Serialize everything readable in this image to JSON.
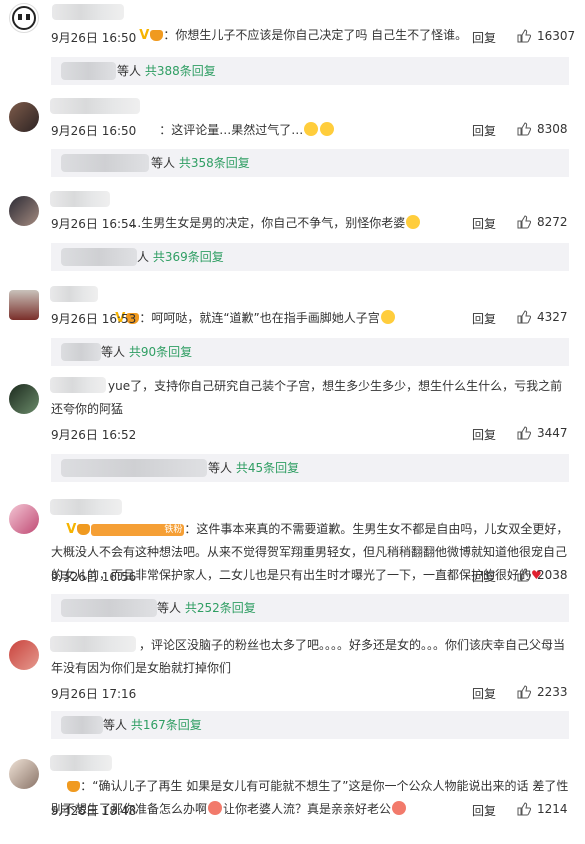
{
  "comments": [
    {
      "text": "：你想生儿子不应该是你自己决定了吗 自己生不了怪谁。",
      "date": "9月26日 16:50",
      "reply_label": "回复",
      "likes": "16307",
      "replies_who": "等人",
      "replies_count": "共388条回复"
    },
    {
      "text": "：这评论量…果然过气了…",
      "date": "9月26日 16:50",
      "reply_label": "回复",
      "likes": "8308",
      "replies_who": "等人",
      "replies_count": "共358条回复"
    },
    {
      "text": "…生男生女是男的决定，你自己不争气，别怪你老婆",
      "date": "9月26日 16:54",
      "reply_label": "回复",
      "likes": "8272",
      "replies_who": "人",
      "replies_count": "共369条回复"
    },
    {
      "text": "：呵呵哒，就连“道歉”也在指手画脚她人子宫",
      "date": "9月26日 16:53",
      "reply_label": "回复",
      "likes": "4327",
      "replies_who": "等人",
      "replies_count": "共90条回复"
    },
    {
      "text": "yue了，支持你自己研究自己装个子宫，想生多少生多少，想生什么生什么，亏我之前还夸你的阿猛",
      "date": "9月26日 16:52",
      "reply_label": "回复",
      "likes": "3447",
      "replies_who": "等人",
      "replies_count": "共45条回复"
    },
    {
      "badge": "铁粉",
      "text": "：这件事本来真的不需要道歉。生男生女不都是自由吗，儿女双全更好，大概没人不会有这种想法吧。从来不觉得贺军翔重男轻女，但凡稍稍翻翻他微博就知道他很宠自己的女儿的，而且非常保护家人，二女儿也是只有出生时才曝光了一下，一直都保护的很好的",
      "date": "9月26日 16:56",
      "reply_label": "回复",
      "likes": "2038",
      "replies_who": "等人",
      "replies_count": "共252条回复"
    },
    {
      "text": "，评论区没脑子的粉丝也太多了吧。。。。好多还是女的。。。你们该庆幸自己父母当年没有因为你们是女胎就打掉你们",
      "date": "9月26日 17:16",
      "reply_label": "回复",
      "likes": "2233",
      "replies_who": "等人",
      "replies_count": "共167条回复"
    },
    {
      "text": "：“确认儿子了再生 如果是女儿有可能就不想生了”这是你一个公众人物能说出来的话 差了性别不想生了那你准备怎么办啊",
      "text_mid": "让你老婆人流？真是亲亲好老公",
      "date": "9月26日 18:48",
      "reply_label": "回复",
      "likes": "1214"
    }
  ]
}
